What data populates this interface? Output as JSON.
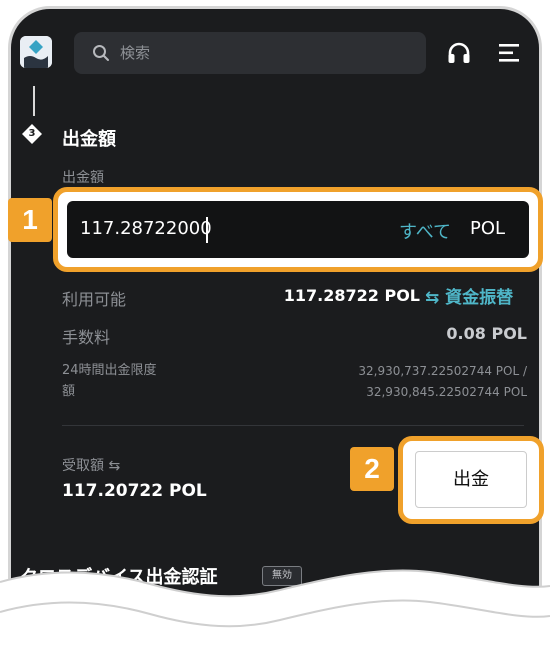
{
  "search": {
    "placeholder": "検索"
  },
  "withdrawal": {
    "step_number": "3",
    "section_title": "出金額",
    "field_label": "出金額",
    "amount_value": "117.28722000",
    "all_button": "すべて",
    "unit": "POL",
    "available_label": "利用可能",
    "available_value": "117.28722 POL",
    "transfer_link": "⇆ 資金振替",
    "fee_label": "手数料",
    "fee_value": "0.08 POL",
    "limit_label_line1": "24時間出金限度",
    "limit_label_line2": "額",
    "limit_value_line1": "32,930,737.22502744 POL /",
    "limit_value_line2": "32,930,845.22502744 POL",
    "receive_label": "受取額 ⇆",
    "receive_value": "117.20722 POL",
    "withdraw_button": "出金"
  },
  "cross_device": {
    "title": "クロスデバイス出金認証",
    "badge": "無効"
  },
  "annotations": {
    "badge_1": "1",
    "badge_2": "2"
  },
  "colors": {
    "accent": "#4fb6c8",
    "highlight": "#f0a12b",
    "background": "#1b1c1e"
  }
}
